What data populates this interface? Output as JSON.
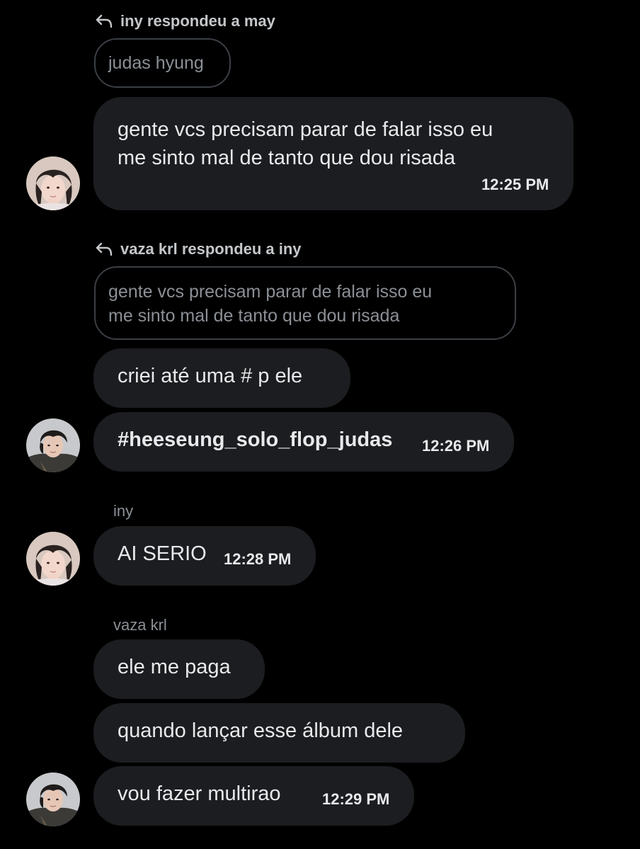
{
  "conversation": {
    "groups": [
      {
        "reply_header": "iny respondeu a may",
        "quoted_text": "judas hyung",
        "messages": [
          {
            "text_line1": "gente vcs precisam parar de falar isso eu",
            "text_line2": "me sinto mal de tanto que dou risada",
            "time": "12:25 PM"
          }
        ]
      },
      {
        "reply_header": "vaza krl respondeu a iny",
        "quoted_line1": "gente vcs precisam parar de falar isso eu",
        "quoted_line2": "me sinto mal de tanto que dou risada",
        "messages": [
          {
            "text": "criei até uma # p ele"
          },
          {
            "text": "#heeseung_solo_flop_judas",
            "time": "12:26 PM"
          }
        ]
      },
      {
        "sender": "iny",
        "messages": [
          {
            "text": "AI SERIO",
            "time": "12:28 PM"
          }
        ]
      },
      {
        "sender": "vaza krl",
        "messages": [
          {
            "text": "ele me paga"
          },
          {
            "text": "quando lançar esse álbum dele"
          },
          {
            "text": "vou fazer multirao",
            "time": "12:29 PM"
          }
        ]
      }
    ]
  },
  "colors": {
    "background": "#000000",
    "bubble": "#1c1d20",
    "text": "#e7e9ea",
    "muted": "#8b9096",
    "quote_border": "#3b3f44"
  },
  "icons": {
    "reply": "reply-arrow-icon",
    "avatar_iny": "avatar-iny",
    "avatar_vaza": "avatar-vaza-krl"
  }
}
